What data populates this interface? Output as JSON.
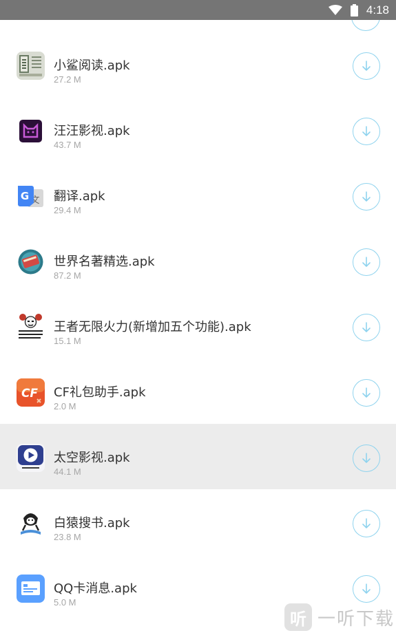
{
  "status_bar": {
    "time": "4:18",
    "wifi_icon": "wifi-icon",
    "battery_icon": "battery-icon"
  },
  "apps": [
    {
      "name": "小鲨阅读.apk",
      "size": "27.2 M",
      "icon": "xiaosha-reader-icon"
    },
    {
      "name": "汪汪影视.apk",
      "size": "43.7 M",
      "icon": "wangwang-video-icon"
    },
    {
      "name": "翻译.apk",
      "size": "29.4 M",
      "icon": "google-translate-icon"
    },
    {
      "name": "世界名著精选.apk",
      "size": "87.2 M",
      "icon": "world-classics-icon"
    },
    {
      "name": "王者无限火力(新增加五个功能).apk",
      "size": "15.1 M",
      "icon": "wangzhe-meme-icon"
    },
    {
      "name": "CF礼包助手.apk",
      "size": "2.0 M",
      "icon": "cf-gift-icon"
    },
    {
      "name": "太空影视.apk",
      "size": "44.1 M",
      "icon": "space-video-icon",
      "highlighted": true
    },
    {
      "name": "白猿搜书.apk",
      "size": "23.8 M",
      "icon": "white-ape-search-icon"
    },
    {
      "name": "QQ卡消息.apk",
      "size": "5.0 M",
      "icon": "qq-card-message-icon"
    }
  ],
  "watermark": {
    "text": "一听下载",
    "logo_glyph": "听"
  },
  "colors": {
    "accent": "#8fd3ee",
    "status_bar": "#757575",
    "highlight_row": "#ececec"
  }
}
